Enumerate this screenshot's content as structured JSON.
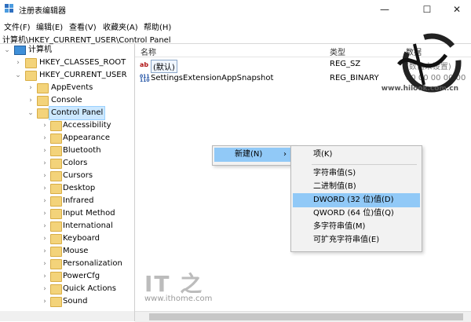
{
  "window": {
    "title": "注册表编辑器",
    "minimize": "—",
    "maximize": "☐",
    "close": "✕"
  },
  "menubar": [
    "文件(F)",
    "编辑(E)",
    "查看(V)",
    "收藏夹(A)",
    "帮助(H)"
  ],
  "address": "计算机\\HKEY_CURRENT_USER\\Control Panel",
  "tree": {
    "root": "计算机",
    "hkcr": "HKEY_CLASSES_ROOT",
    "hkcu": "HKEY_CURRENT_USER",
    "appevents": "AppEvents",
    "console": "Console",
    "control_panel": "Control Panel",
    "children": [
      "Accessibility",
      "Appearance",
      "Bluetooth",
      "Colors",
      "Cursors",
      "Desktop",
      "Infrared",
      "Input Method",
      "International",
      "Keyboard",
      "Mouse",
      "Personalization",
      "PowerCfg",
      "Quick Actions",
      "Sound"
    ]
  },
  "columns": {
    "name": "名称",
    "type": "类型",
    "data": "数据"
  },
  "values": [
    {
      "name": "(默认)",
      "type": "REG_SZ",
      "data": "(数值未设置)",
      "icon": "string-value-icon"
    },
    {
      "name": "SettingsExtensionAppSnapshot",
      "type": "REG_BINARY",
      "data": "00 00 00 00 00",
      "icon": "binary-value-icon"
    }
  ],
  "context_menu": {
    "new_label": "新建(N)",
    "arrow": "›"
  },
  "submenu": {
    "key": "项(K)",
    "items": [
      "字符串值(S)",
      "二进制值(B)",
      "DWORD (32 位)值(D)",
      "QWORD (64 位)值(Q)",
      "多字符串值(M)",
      "可扩充字符串值(E)"
    ]
  },
  "watermarks": {
    "hilook_text": "晨风",
    "hilook_url": "www.hilook.com.cn",
    "ithome": "IT之家",
    "ithome_url": "www.ithome.com"
  },
  "colors": {
    "selection": "#cce8ff",
    "menu_highlight": "#91c9f7",
    "folder": "#f3d37a"
  }
}
